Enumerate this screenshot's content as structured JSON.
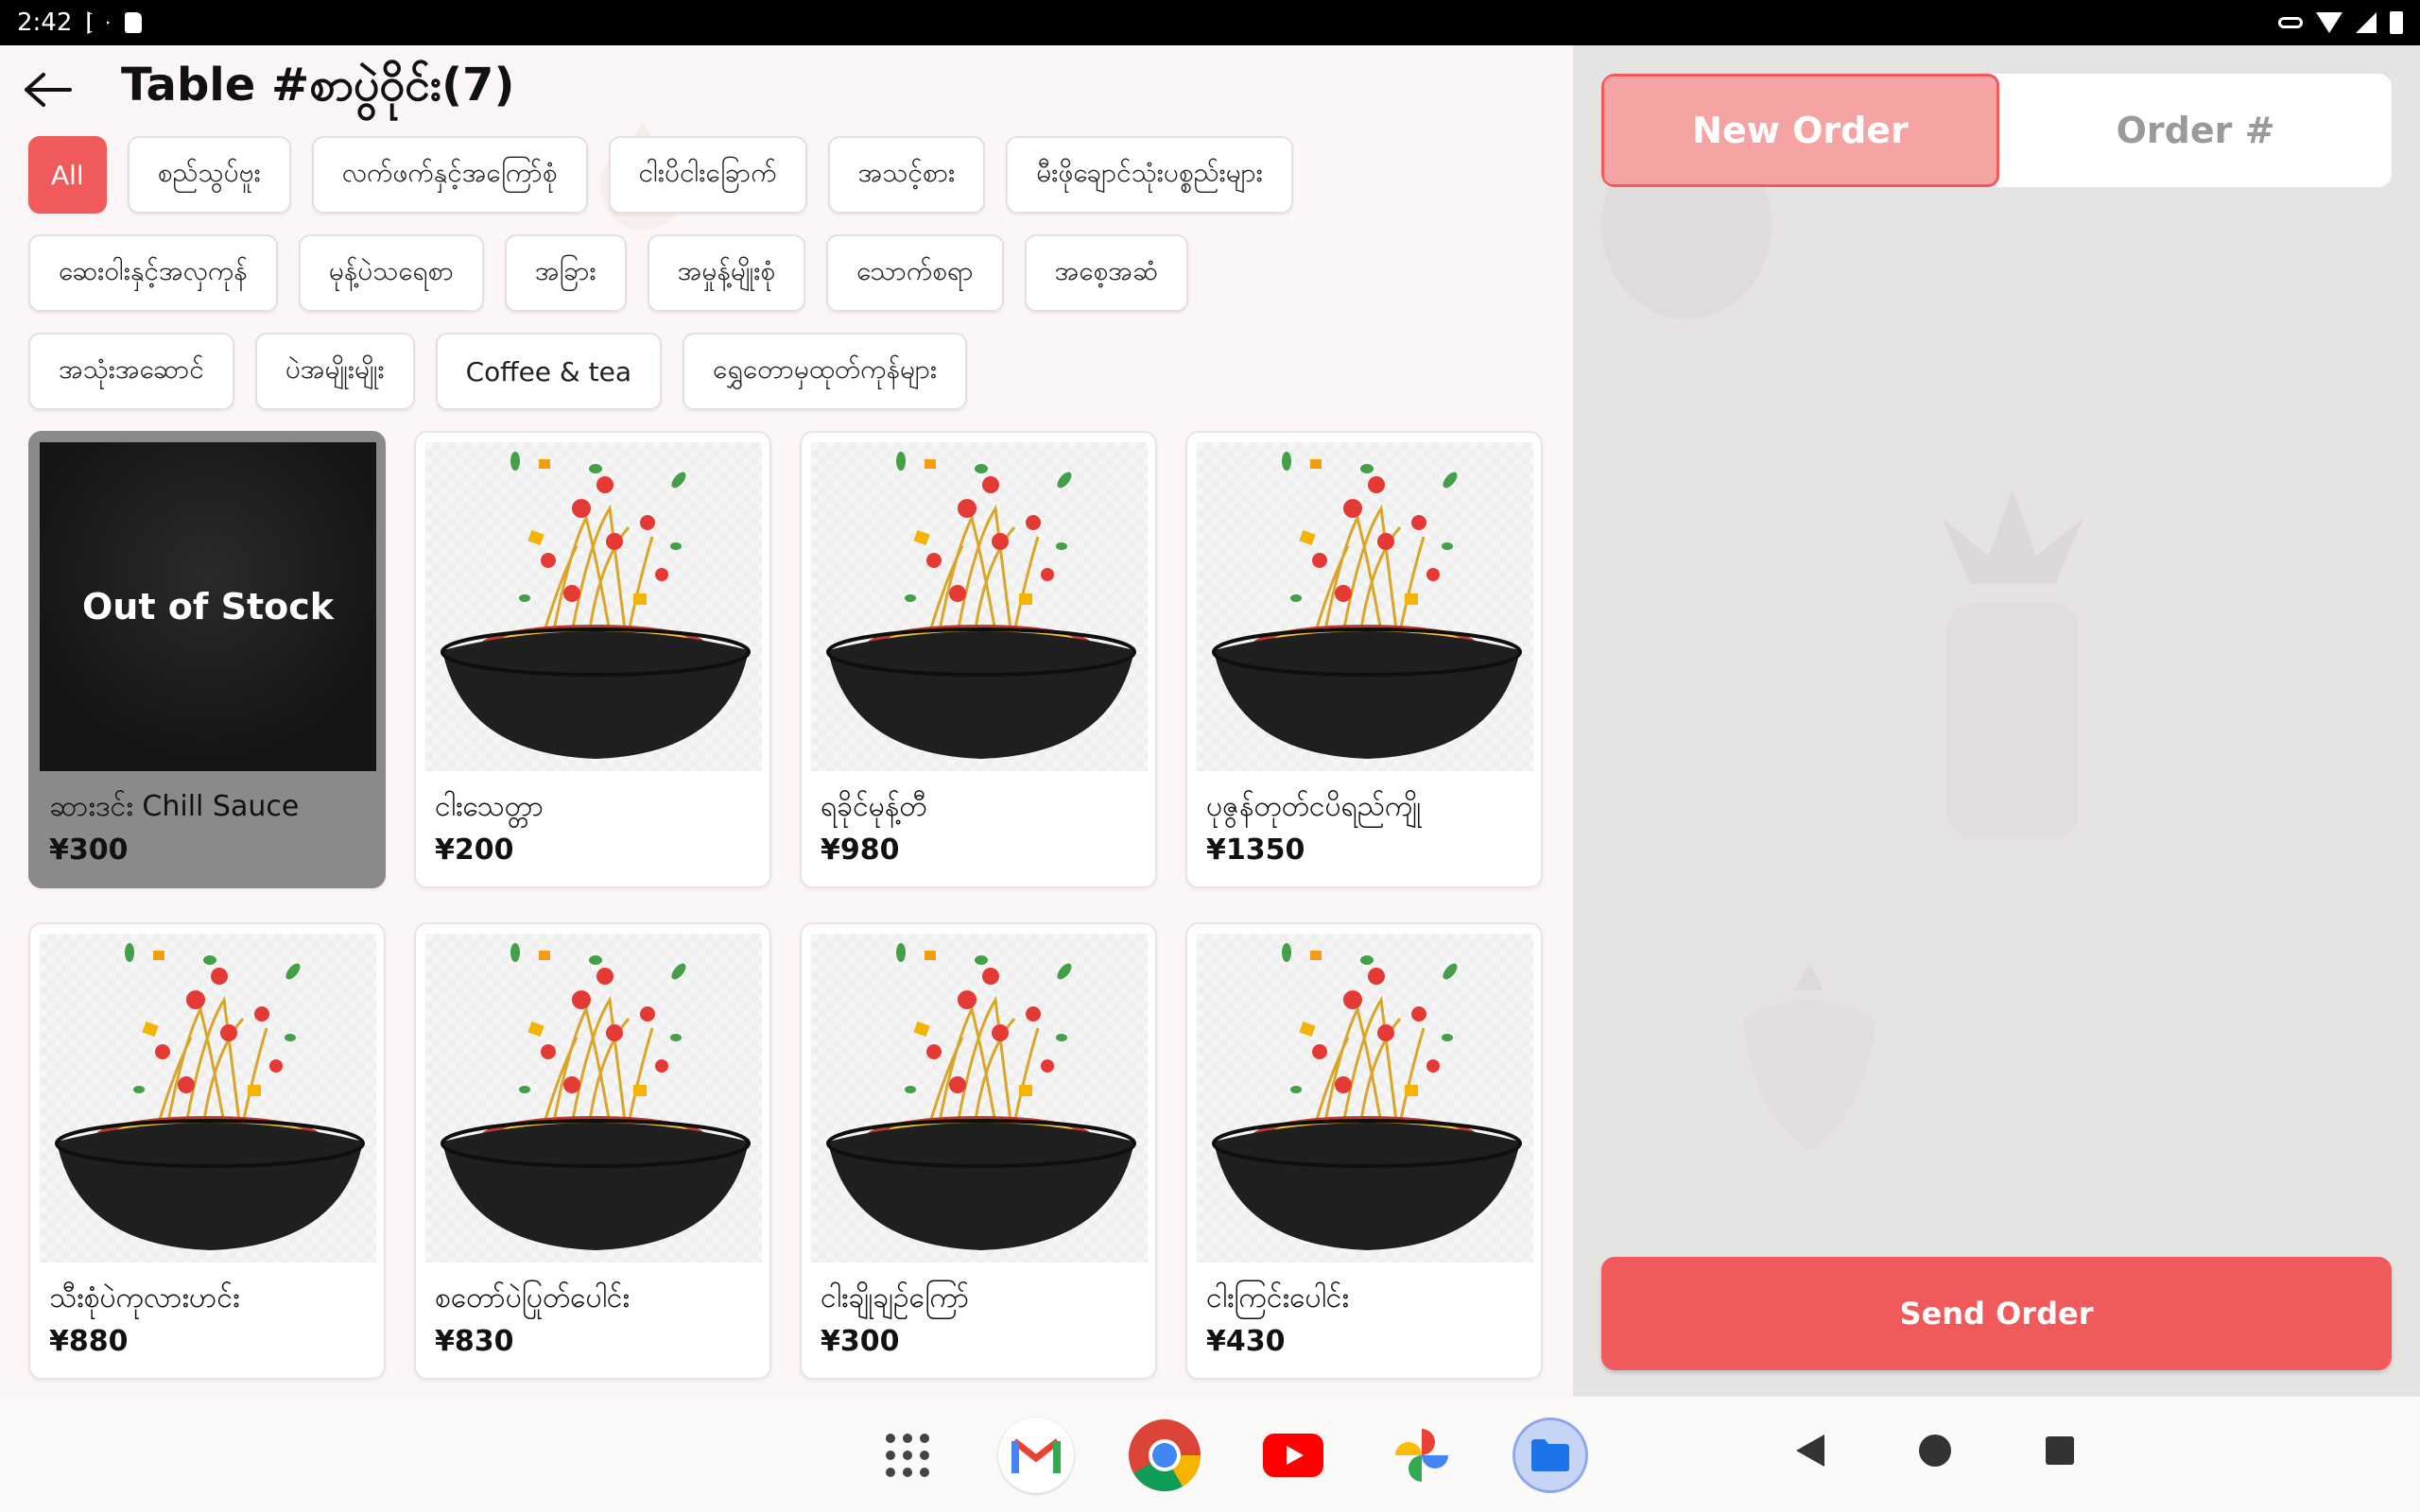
{
  "status_bar": {
    "time": "2:42"
  },
  "header": {
    "title": "Table #စာပွဲဝိုင်း(7)"
  },
  "categories": [
    "All",
    "စည်သွပ်ဗူး",
    "လက်ဖက်နှင့်အကြော်စုံ",
    "ငါးပိငါးခြောက်",
    "အသင့်စား",
    "မီးဖိုချောင်သုံးပစ္စည်းများ",
    "ဆေးဝါးနှင့်အလှကုန်",
    "မုန့်ပဲသရေစာ",
    "အခြား",
    "အမှုန့်မျိုးစုံ",
    "သောက်စရာ",
    "အစေ့အဆံ",
    "အသုံးအဆောင်",
    "ပဲအမျိုးမျိုး",
    "Coffee & tea",
    "ရွှေတောမှထုတ်ကုန်များ"
  ],
  "products": [
    {
      "name": "ဆားဒင်း Chill Sauce",
      "price": "¥300",
      "overlay": "Out of Stock"
    },
    {
      "name": "ငါးသေတ္တာ",
      "price": "¥200"
    },
    {
      "name": "ရခိုင်မုန့်တီ",
      "price": "¥980"
    },
    {
      "name": "ပုဇွန်တုတ်ငပိရည်ကျို",
      "price": "¥1350"
    },
    {
      "name": "သီးစုံပဲကုလားဟင်း",
      "price": "¥880"
    },
    {
      "name": "စတော်ပဲပြုတ်ပေါင်း",
      "price": "¥830"
    },
    {
      "name": "ငါးချိုချဉ်ကြော်",
      "price": "¥300"
    },
    {
      "name": "ငါးကြင်းပေါင်း",
      "price": "¥430"
    }
  ],
  "order_panel": {
    "new_order_label": "New Order",
    "order_number_label": "Order #",
    "send_order_label": "Send Order"
  },
  "colors": {
    "accent": "#f05a5a",
    "accent_light": "#f5a3a3"
  },
  "dock_apps": [
    "app-drawer-icon",
    "gmail-icon",
    "chrome-icon",
    "youtube-icon",
    "photos-icon",
    "files-icon"
  ]
}
